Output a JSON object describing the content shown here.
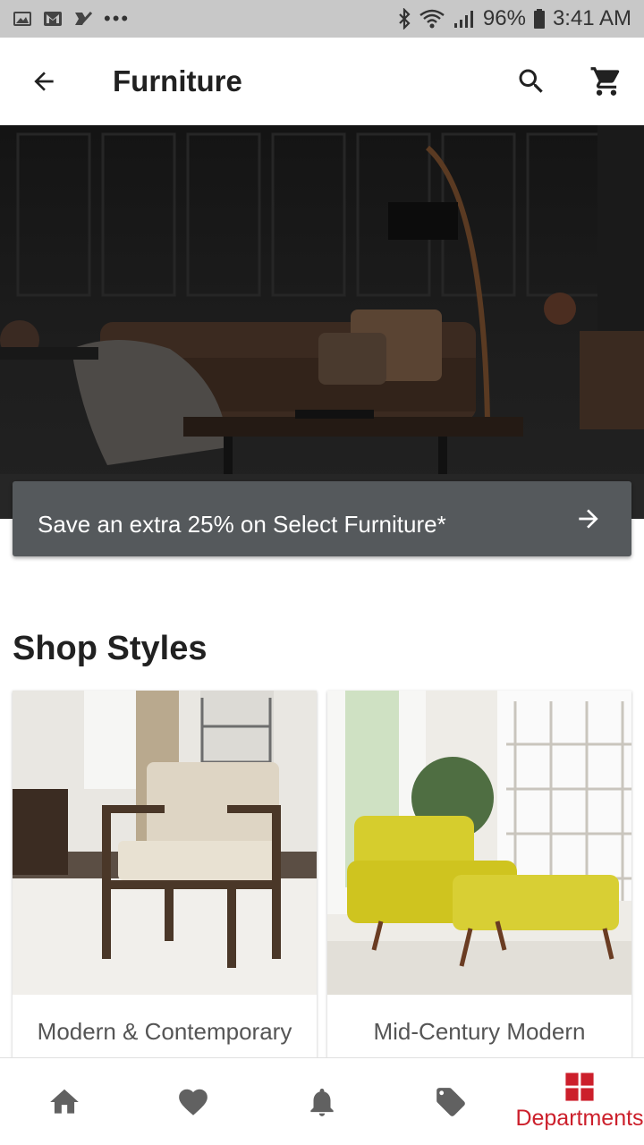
{
  "status_bar": {
    "battery": "96%",
    "time": "3:41 AM",
    "left_icons": [
      "gallery-icon",
      "gmail-icon",
      "checkmark-icon",
      "overflow-dots-icon"
    ],
    "right_icons": [
      "bluetooth-icon",
      "wifi-icon",
      "signal-icon",
      "battery-icon"
    ]
  },
  "app_bar": {
    "title": "Furniture",
    "icons": [
      "back-arrow-icon",
      "search-icon",
      "cart-icon"
    ]
  },
  "hero": {
    "image_alt": "Dark living room with leather sofa and arc floor lamp",
    "promo_text": "Save an extra 25% on Select Furniture*"
  },
  "shop_styles": {
    "title": "Shop Styles",
    "cards": [
      {
        "label": "Modern & Contemporary"
      },
      {
        "label": "Mid-Century Modern"
      }
    ]
  },
  "bottom_nav": {
    "items": [
      {
        "icon": "home-icon",
        "label": ""
      },
      {
        "icon": "heart-icon",
        "label": ""
      },
      {
        "icon": "bell-icon",
        "label": ""
      },
      {
        "icon": "tag-icon",
        "label": ""
      },
      {
        "icon": "departments-grid-icon",
        "label": "Departments"
      }
    ],
    "active_index": 4
  },
  "colors": {
    "accent": "#cc1f2b",
    "status_bar_bg": "#c8c8c8",
    "promo_bg": "#55595c",
    "icon_gray": "#616161"
  }
}
